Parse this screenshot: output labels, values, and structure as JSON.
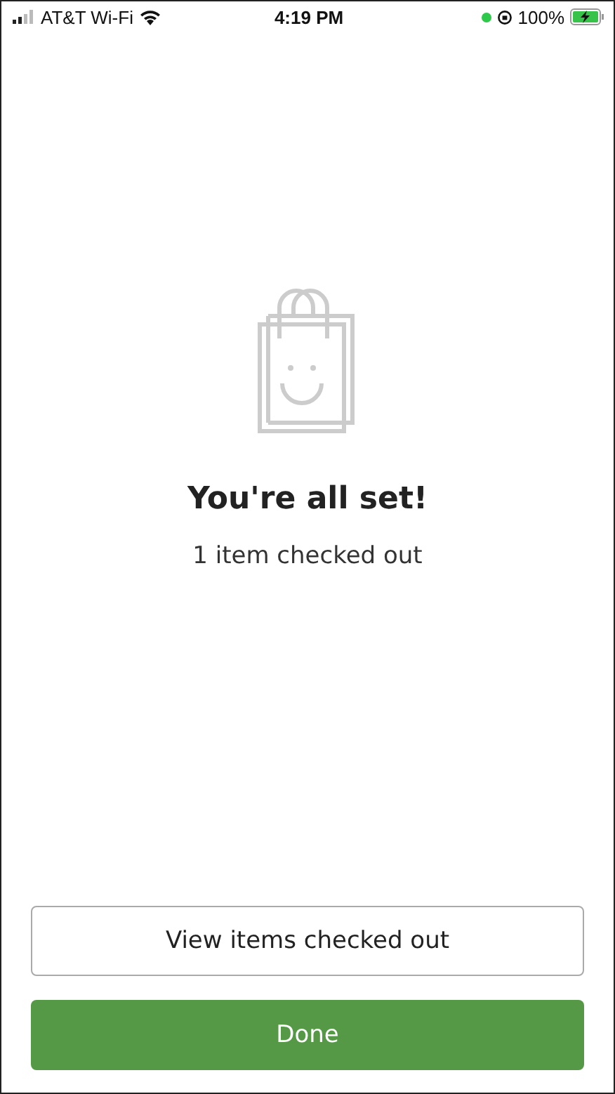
{
  "status_bar": {
    "carrier": "AT&T Wi-Fi",
    "time": "4:19 PM",
    "battery": "100%",
    "charging": true
  },
  "confirmation": {
    "title": "You're all set!",
    "subtitle": "1 item checked out"
  },
  "buttons": [
    {
      "label": "View items checked out",
      "kind": "secondary"
    },
    {
      "label": "Done",
      "kind": "primary"
    }
  ]
}
